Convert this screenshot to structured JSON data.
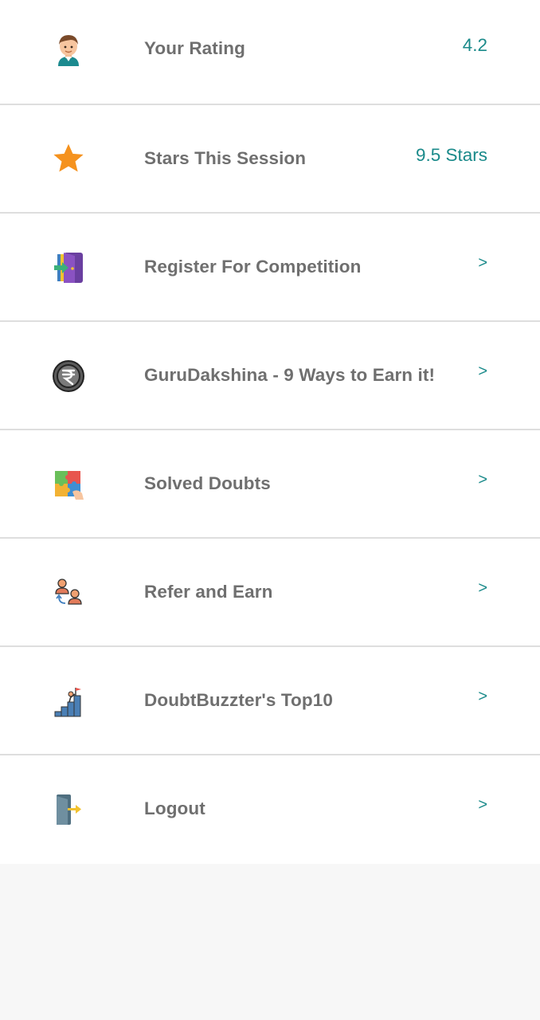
{
  "menu": {
    "items": [
      {
        "label": "Your Rating",
        "value": "4.2",
        "icon": "user-avatar-icon"
      },
      {
        "label": "Stars This Session",
        "value": "9.5 Stars",
        "icon": "star-icon"
      },
      {
        "label": "Register For Competition",
        "value": ">",
        "icon": "door-enter-icon"
      },
      {
        "label": "GuruDakshina - 9 Ways to Earn it!",
        "value": ">",
        "icon": "rupee-coin-icon"
      },
      {
        "label": "Solved Doubts",
        "value": ">",
        "icon": "puzzle-icon"
      },
      {
        "label": "Refer and Earn",
        "value": ">",
        "icon": "refer-people-icon"
      },
      {
        "label": "DoubtBuzzter's Top10",
        "value": ">",
        "icon": "leaderboard-flag-icon"
      },
      {
        "label": "Logout",
        "value": ">",
        "icon": "logout-door-icon"
      }
    ]
  },
  "colors": {
    "accent": "#1a8a8a",
    "label": "#6f6f6f",
    "divider": "#dedede",
    "star": "#f5921e"
  }
}
